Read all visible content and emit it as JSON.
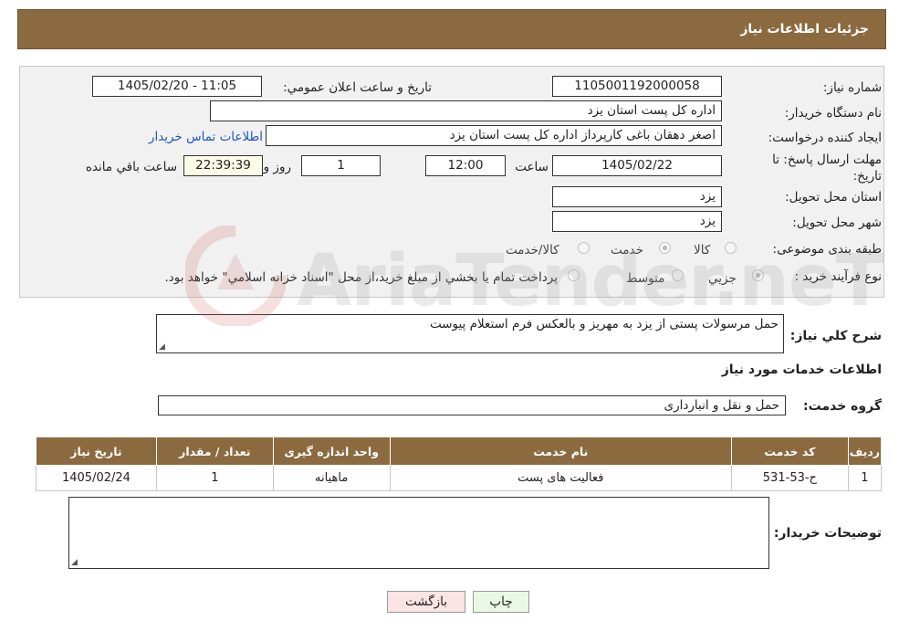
{
  "header": {
    "title": "جزئیات اطلاعات نیاز"
  },
  "form": {
    "need_number_label": "شماره نیاز:",
    "need_number": "1105001192000058",
    "announce_label": "تاريخ و ساعت اعلان عمومي:",
    "announce_value": "1405/02/20 - 11:05",
    "buyer_org_label": "نام دستگاه خريدار:",
    "buyer_org": "اداره کل پست استان یزد",
    "creator_label": "ايجاد کننده درخواست:",
    "creator": "اصغر دهقان باغی کارپرداز اداره کل پست استان یزد",
    "contact_link": "اطلاعات تماس خريدار",
    "deadline_label_1": "مهلت ارسال پاسخ: تا",
    "deadline_label_2": "تاريخ:",
    "deadline_date": "1405/02/22",
    "time_label": "ساعت",
    "deadline_time": "12:00",
    "days_value": "1",
    "days_label": "روز و",
    "remaining_time": "22:39:39",
    "remaining_label": "ساعت باقي مانده",
    "province_label": "استان محل تحويل:",
    "province": "یزد",
    "city_label": "شهر محل تحويل:",
    "city": "یزد",
    "category_label": "طبقه بندی موضوعی:",
    "category_options": [
      "کالا",
      "خدمت",
      "کالا/خدمت"
    ],
    "category_selected": "خدمت",
    "process_label": "نوع فرآيند خريد :",
    "process_options": [
      "جزيي",
      "متوسط"
    ],
    "process_note": "پرداخت تمام يا بخشي از مبلغ خريد،از محل \"اسناد خزانه اسلامي\" خواهد بود."
  },
  "description": {
    "label": "شرح کلي نياز:",
    "text": "حمل مرسولات پستی از یزد به مهریز و بالعکس فرم استعلام پیوست"
  },
  "services": {
    "title": "اطلاعات خدمات مورد نياز",
    "group_label": "گروه خدمت:",
    "group_value": "حمل و نقل و انبارداری",
    "columns": [
      "رديف",
      "کد خدمت",
      "نام خدمت",
      "واحد اندازه گيری",
      "تعداد / مقدار",
      "تاريخ نياز"
    ],
    "rows": [
      [
        "1",
        "ح-53-531",
        "فعالیت های پست",
        "ماهيانه",
        "1",
        "1405/02/24"
      ]
    ]
  },
  "buyer_notes": {
    "label": "توضيحات خريدار:",
    "text": ""
  },
  "buttons": {
    "print": "چاپ",
    "back": "بازگشت"
  },
  "watermark": {
    "text": "AriaTender.neT"
  },
  "colors": {
    "header_bg": "#8b6a3f",
    "link": "#1c57c4"
  }
}
